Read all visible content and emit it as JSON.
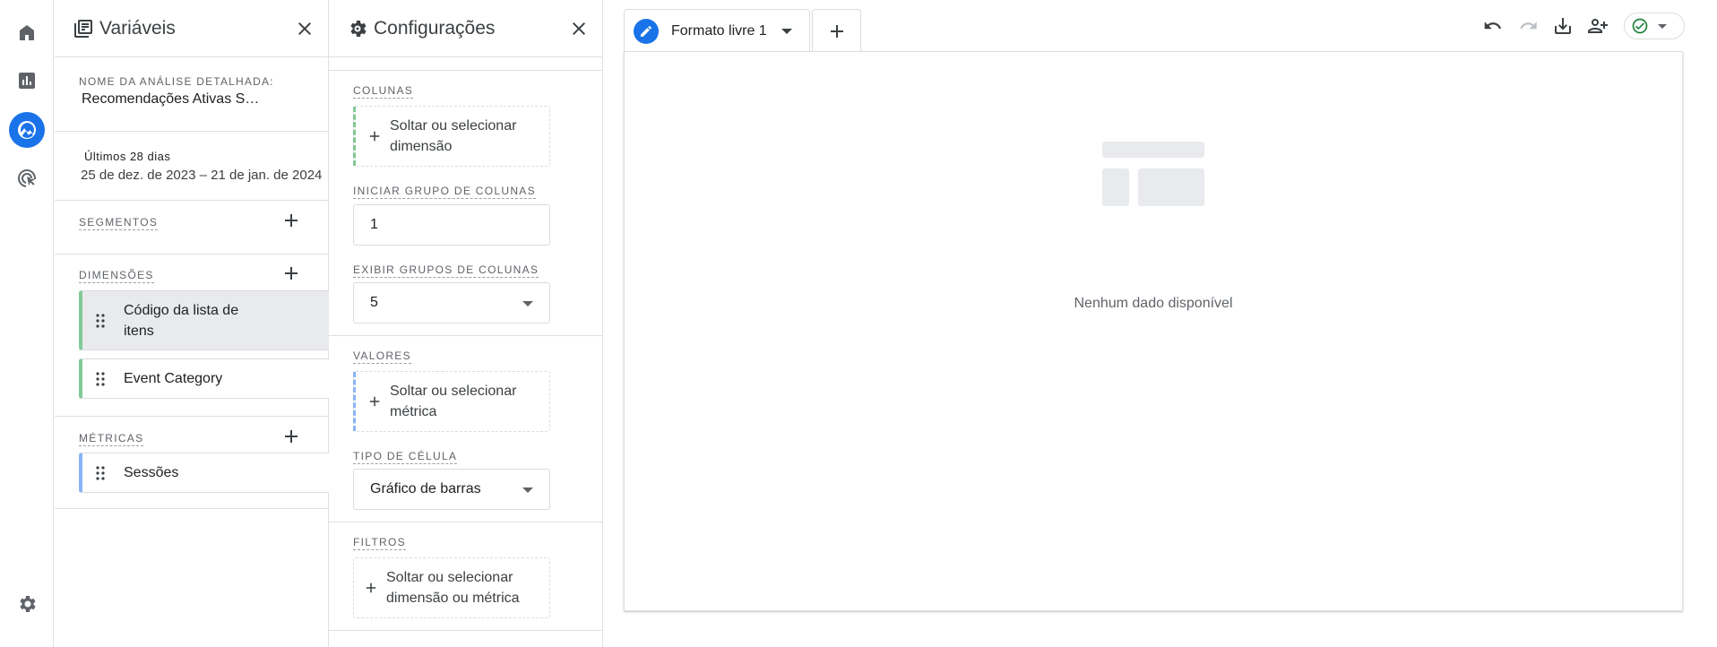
{
  "rail": {
    "items": [
      {
        "icon": "home-icon"
      },
      {
        "icon": "reports-icon"
      },
      {
        "icon": "explore-icon",
        "active": true
      },
      {
        "icon": "advertising-icon"
      }
    ],
    "settings_icon": "gear-icon"
  },
  "variables": {
    "title": "Variáveis",
    "analysis_name_label": "NOME DA ANÁLISE DETALHADA:",
    "analysis_name_value": "Recomendações Ativas S…",
    "date_range_label": "Últimos 28 dias",
    "date_range_value": "25 de dez. de 2023 – 21 de jan. de 2024",
    "segments_label": "SEGMENTOS",
    "dimensions_label": "DIMENSÕES",
    "dimensions": [
      "Código da lista de itens",
      "Event Category"
    ],
    "metrics_label": "MÉTRICAS",
    "metrics": [
      "Sessões"
    ]
  },
  "settings": {
    "title": "Configurações",
    "columns_label": "COLUNAS",
    "columns_drop": "Soltar ou selecionar dimensão",
    "start_group_label": "INICIAR GRUPO DE COLUNAS",
    "start_group_value": "1",
    "show_groups_label": "EXIBIR GRUPOS DE COLUNAS",
    "show_groups_value": "5",
    "values_label": "VALORES",
    "values_drop": "Soltar ou selecionar métrica",
    "cell_type_label": "TIPO DE CÉLULA",
    "cell_type_value": "Gráfico de barras",
    "filters_label": "FILTROS",
    "filters_drop": "Soltar ou selecionar dimensão ou métrica"
  },
  "tabs": [
    {
      "label": "Formato livre 1"
    }
  ],
  "canvas": {
    "empty_text": "Nenhum dado disponível"
  },
  "colors": {
    "accent": "#1a73e8",
    "dimension": "#81c995",
    "metric": "#8ab4f8",
    "status_ok": "#188038"
  }
}
